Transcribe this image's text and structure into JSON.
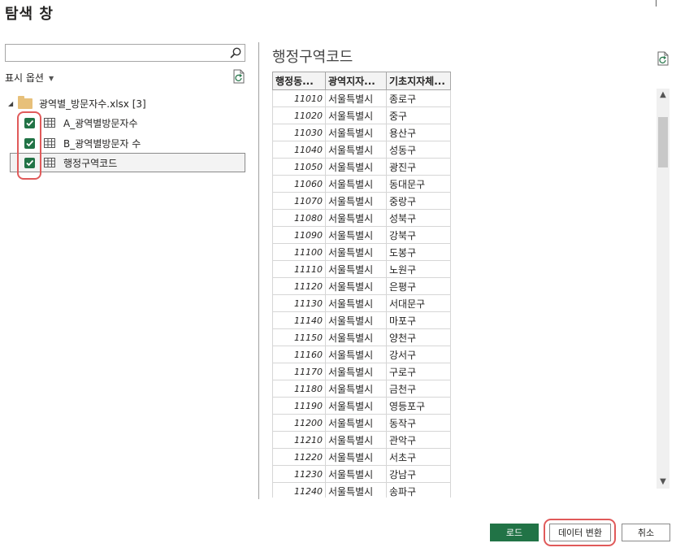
{
  "window": {
    "title": "탐색 창"
  },
  "search": {
    "value": "",
    "placeholder": ""
  },
  "display_options": {
    "label": "표시 옵션"
  },
  "tree": {
    "root_label": "광역별_방문자수.xlsx [3]",
    "items": [
      {
        "label": "A_광역별방문자수",
        "checked": true,
        "selected": false
      },
      {
        "label": "B_광역별방문자 수",
        "checked": true,
        "selected": false
      },
      {
        "label": "행정구역코드",
        "checked": true,
        "selected": true
      }
    ]
  },
  "preview": {
    "title": "행정구역코드",
    "columns": [
      "행정동...",
      "광역지자...",
      "기초지자체..."
    ],
    "rows": [
      [
        "11010",
        "서울특별시",
        "종로구"
      ],
      [
        "11020",
        "서울특별시",
        "중구"
      ],
      [
        "11030",
        "서울특별시",
        "용산구"
      ],
      [
        "11040",
        "서울특별시",
        "성동구"
      ],
      [
        "11050",
        "서울특별시",
        "광진구"
      ],
      [
        "11060",
        "서울특별시",
        "동대문구"
      ],
      [
        "11070",
        "서울특별시",
        "중랑구"
      ],
      [
        "11080",
        "서울특별시",
        "성북구"
      ],
      [
        "11090",
        "서울특별시",
        "강북구"
      ],
      [
        "11100",
        "서울특별시",
        "도봉구"
      ],
      [
        "11110",
        "서울특별시",
        "노원구"
      ],
      [
        "11120",
        "서울특별시",
        "은평구"
      ],
      [
        "11130",
        "서울특별시",
        "서대문구"
      ],
      [
        "11140",
        "서울특별시",
        "마포구"
      ],
      [
        "11150",
        "서울특별시",
        "양천구"
      ],
      [
        "11160",
        "서울특별시",
        "강서구"
      ],
      [
        "11170",
        "서울특별시",
        "구로구"
      ],
      [
        "11180",
        "서울특별시",
        "금천구"
      ],
      [
        "11190",
        "서울특별시",
        "영등포구"
      ],
      [
        "11200",
        "서울특별시",
        "동작구"
      ],
      [
        "11210",
        "서울특별시",
        "관악구"
      ],
      [
        "11220",
        "서울특별시",
        "서초구"
      ],
      [
        "11230",
        "서울특별시",
        "강남구"
      ],
      [
        "11240",
        "서울특별시",
        "송파구"
      ]
    ]
  },
  "buttons": {
    "load": "로드",
    "transform": "데이터 변환",
    "cancel": "취소"
  },
  "colors": {
    "accent": "#217346",
    "highlight": "#e05a5a"
  }
}
